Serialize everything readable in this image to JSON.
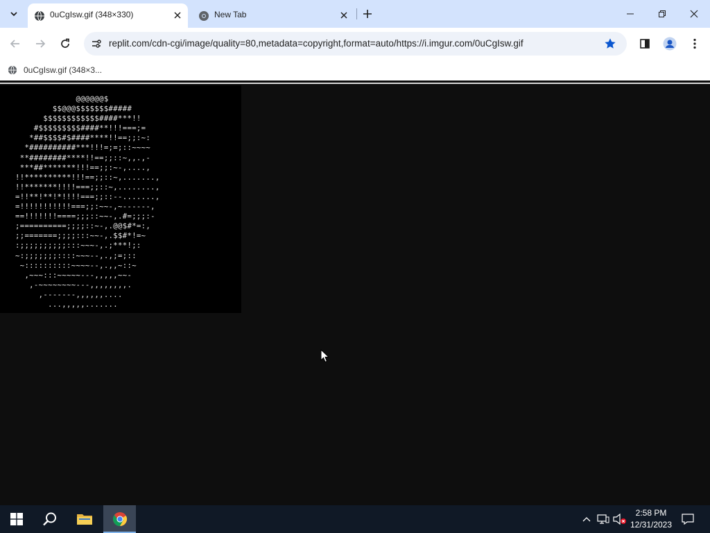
{
  "browser": {
    "tabs": [
      {
        "title": "0uCgIsw.gif (348×330)",
        "active": true
      },
      {
        "title": "New Tab",
        "active": false
      }
    ],
    "url": "replit.com/cdn-cgi/image/quality=80,metadata=copyright,format=auto/https://i.imgur.com/0uCgIsw.gif",
    "bookmarked": true,
    "bookmarks": [
      {
        "label": "0uCgIsw.gif (348×3..."
      }
    ],
    "accent_color": "#d3e3fd",
    "star_color": "#0b57d0"
  },
  "content": {
    "image_name": "0uCgIsw.gif",
    "image_size": "348×330",
    "ascii_art": "             @@@@@@$\n        $$@@@$$$$$$$#####\n      $$$$$$$$$$$$####***!!\n    #$$$$$$$$$####**!!!===;=\n   *##$$$$#$####****!!==;;:~:\n  *##########***!!!=;=;::~~~~\n **########****!!==;;::~,,.,-\n ***##*******!!!==;;:~-,....,\n!!**********!!!==;;::~,.......,\n!!*******!!!!===;;::~,........,\n=!!**!**!*!!!!===;;::--.......,\n=!!!!!!!!!!!===;;:~~-,~------,\n==!!!!!!!====;;;::~~-,.#=;;;:-\n;==========;;;;::~-,.@@$#*=:,\n;;=======;;;;:::~~-,.$$#*!=~\n:;;;;;;;;;;:::~~~-,.;***!;:\n~:;;;;;;;::::~~~--,.,;=;::\n ~::::::::::~~~~--,.,,~::~\n  ,~~~:::~~~~~---,,,,,~~-\n   ,-~~~~~~~~---,,,,,,,,.\n     ,-------,,,,,,....\n       ...,,,,,......."
  },
  "taskbar": {
    "apps": [
      {
        "name": "Start",
        "icon": "windows-logo-icon"
      },
      {
        "name": "Search",
        "icon": "search-icon"
      },
      {
        "name": "File Explorer",
        "icon": "folder-icon"
      },
      {
        "name": "Google Chrome",
        "icon": "chrome-icon",
        "active": true
      }
    ],
    "time": "2:58 PM",
    "date": "12/31/2023"
  }
}
